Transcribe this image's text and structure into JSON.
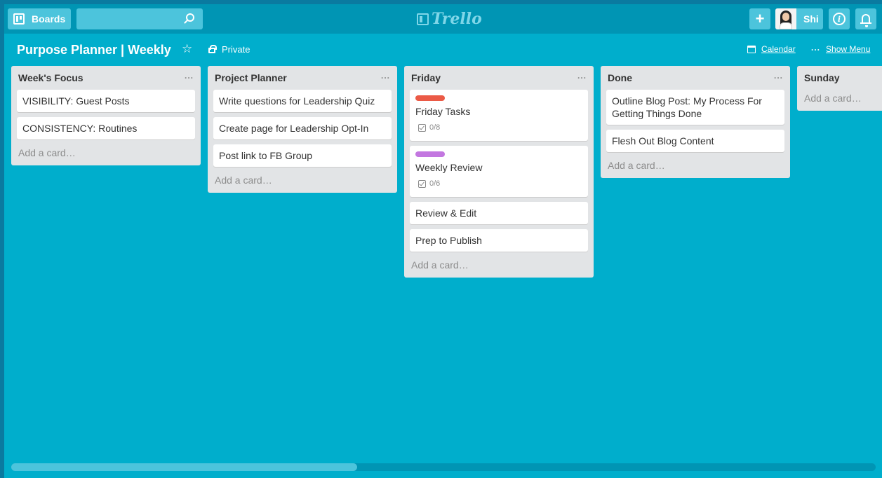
{
  "header": {
    "boards_label": "Boards",
    "search_placeholder": "",
    "logo_text": "Trello",
    "member_name": "Shi"
  },
  "board": {
    "title": "Purpose Planner | Weekly",
    "visibility": "Private",
    "calendar_label": "Calendar",
    "show_menu_label": "Show Menu"
  },
  "lists": [
    {
      "title": "Week's Focus",
      "cards": [
        {
          "title": "VISIBILITY: Guest Posts"
        },
        {
          "title": "CONSISTENCY: Routines"
        }
      ],
      "add_card": "Add a card…"
    },
    {
      "title": "Project Planner",
      "cards": [
        {
          "title": "Write questions for Leadership Quiz"
        },
        {
          "title": "Create page for Leadership Opt-In"
        },
        {
          "title": "Post link to FB Group"
        }
      ],
      "add_card": "Add a card…"
    },
    {
      "title": "Friday",
      "cards": [
        {
          "title": "Friday Tasks",
          "label_color": "#eb5a46",
          "checklist": "0/8"
        },
        {
          "title": "Weekly Review",
          "label_color": "#c377e0",
          "checklist": "0/6"
        },
        {
          "title": "Review & Edit"
        },
        {
          "title": "Prep to Publish"
        }
      ],
      "add_card": "Add a card…"
    },
    {
      "title": "Done",
      "cards": [
        {
          "title": "Outline Blog Post: My Process For Getting Things Done"
        },
        {
          "title": "Flesh Out Blog Content"
        }
      ],
      "add_card": "Add a card…"
    },
    {
      "title": "Sunday",
      "cards": [],
      "add_card": "Add a card…"
    }
  ],
  "colors": {
    "board_bg": "#00aecc",
    "header_bg": "#0095b4",
    "label_red": "#eb5a46",
    "label_purple": "#c377e0"
  },
  "horizontal_scroll_fraction": 0.4
}
